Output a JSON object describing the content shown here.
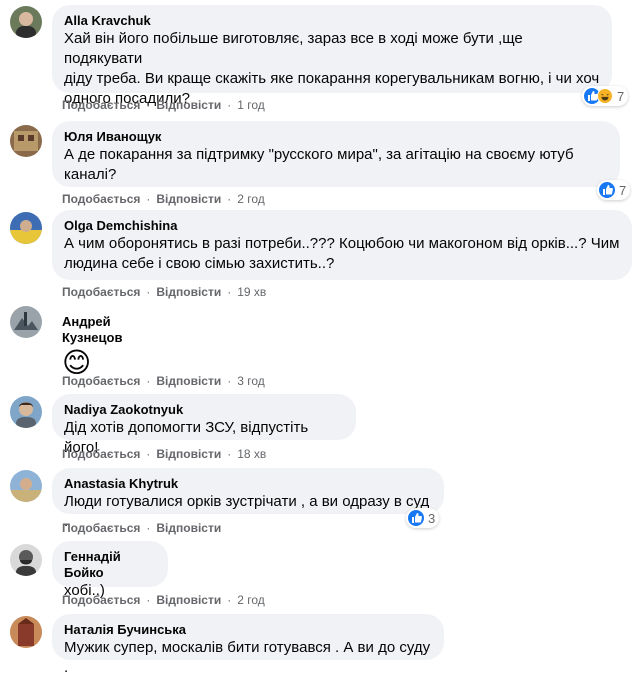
{
  "actions": {
    "like_label": "Подобається",
    "reply_label": "Відповісти"
  },
  "comments": [
    {
      "author": "Alla Kravchuk",
      "lines": [
        "Хай він його побільше виготовляє, зараз все в ході може бути ,ще подякувати",
        "діду треба. Ви краще скажіть яке покарання корегувальникам вогню, і чи хоч",
        "одного посадили?"
      ],
      "time": "1 год",
      "reactions": "7",
      "reaction_icons": [
        "like-icon",
        "haha-icon"
      ]
    },
    {
      "author": "Юля Иванощук",
      "lines": [
        "А де покарання за підтримку \"русского мира\", за агітацію на своєму ютуб",
        "каналі?"
      ],
      "time": "2 год",
      "reactions": "7",
      "reaction_icons": [
        "like-icon"
      ]
    },
    {
      "author": "Olga Demchishina",
      "lines": [
        "А чим оборонятись в разі потреби..??? Коцюбою чи макогоном від орків...? Чим",
        "людина себе і свою сімью захистить..?"
      ],
      "time": "19 хв"
    },
    {
      "author": "Андрей Кузнецов",
      "emoji": "😊",
      "time": "3 год"
    },
    {
      "author": "Nadiya Zaokotnyuk",
      "lines": [
        "Дід хотів допомогти ЗСУ, відпустіть його!"
      ],
      "time": "18 хв"
    },
    {
      "author": "Anastasia Khytruk",
      "lines": [
        "Люди готувалися орків зустрічати , а ви одразу в суд ."
      ],
      "time": "",
      "reactions": "3",
      "reaction_icons": [
        "like-icon"
      ]
    },
    {
      "author": "Геннадій Бойко",
      "lines": [
        "хобі..)"
      ],
      "time": "2 год"
    },
    {
      "author": "Наталія Бучинська",
      "lines": [
        "Мужик супер, москалів бити готувався . А ви до суду ."
      ]
    }
  ],
  "colors": {
    "bubble": "#f0f2f5",
    "meta": "#65676b",
    "like": "#1877f2",
    "haha": "#f7b125"
  }
}
